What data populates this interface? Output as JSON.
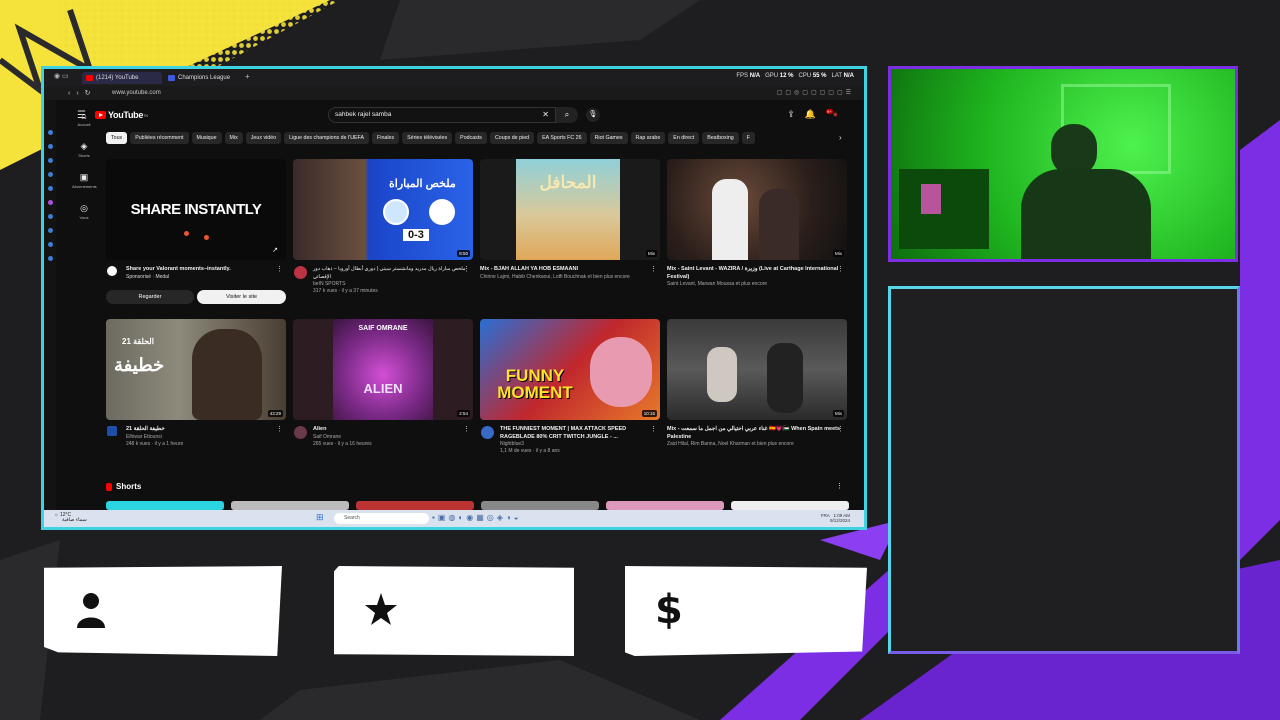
{
  "browser": {
    "tabs": [
      {
        "label": "(1214) YouTube",
        "favicon_color": "#ff0000"
      },
      {
        "label": "Champions League Stand...",
        "favicon_color": "#3b5bdb"
      }
    ],
    "new_tab": "+",
    "stats": {
      "fps_label": "FPS",
      "fps": "N/A",
      "gpu_label": "GPU",
      "gpu": "12 %",
      "cpu_label": "CPU",
      "cpu": "55 %",
      "lat_label": "LAT",
      "lat": "N/A"
    },
    "url": "www.youtube.com"
  },
  "youtube": {
    "logo": "YouTube",
    "logo_region": "TN",
    "search_value": "sahbek rajel samba",
    "notification_count": "9+",
    "left_nav": [
      {
        "label": "Accueil",
        "icon": "home-icon"
      },
      {
        "label": "Shorts",
        "icon": "shorts-icon"
      },
      {
        "label": "Abonnements",
        "icon": "subscriptions-icon"
      },
      {
        "label": "Vous",
        "icon": "you-icon"
      }
    ],
    "chips": [
      "Tous",
      "Publiées récemment",
      "Musique",
      "Mix",
      "Jeux vidéo",
      "Ligue des champions de l'UEFA",
      "Finales",
      "Séries télévisées",
      "Podcasts",
      "Coups de pied",
      "EA Sports FC 26",
      "Riot Games",
      "Rap arabe",
      "En direct",
      "Beatboxing",
      "F"
    ],
    "videos": [
      {
        "thumb_text": "SHARE INSTANTLY",
        "duration": "",
        "title": "Share your Valorant moments–instantly.",
        "line2": "Sponsorisé · Medal",
        "line3": "",
        "ad_buttons": [
          "Regarder",
          "Visiter le site"
        ]
      },
      {
        "thumb_text": "ملخص المباراة",
        "score": "0-3",
        "duration": "8:50",
        "title": "ملخص مباراة ريال مدريد ومانشستر سيتي | دوري أبطال أوروبا – ذهاب دور الإقصائي",
        "line2": "beIN SPORTS",
        "line3": "317 k vues · il y a 37 minutes"
      },
      {
        "thumb_text": "المحافل",
        "duration": "Mix",
        "title": "Mix - BJAH ALLAH YA HOB ESMAANI",
        "line2": "Chirine Lajmi, Habib Chenkaoui, Lotfi Bouchnak et bien plus encore",
        "line3": ""
      },
      {
        "thumb_text": "",
        "duration": "Mix",
        "title": "Mix - Saint Levant - WAZIRA / وزيرة (Live at Carthage International Festival)",
        "line2": "Saint Levant, Marwan Moussa et plus encore",
        "line3": ""
      },
      {
        "thumb_text": "الحلقة 21",
        "thumb_text2": "خطيفة",
        "duration": "43:29",
        "title": "خطيفة الحلقة 21",
        "line2": "Elhiwar Ettounsi",
        "line3": "248 k vues · il y a 1 heure"
      },
      {
        "thumb_text": "SAIF OMRANE",
        "thumb_text2": "ALIEN",
        "duration": "2:54",
        "title": "Alien",
        "line2": "Saif Omrane",
        "line3": "265 vues · il y a 16 heures"
      },
      {
        "thumb_text": "FUNNY MOMENT",
        "duration": "10:16",
        "title": "THE FUNNIEST MOMENT | MAX ATTACK SPEED RAGEBLADE 80% CRIT TWITCH JUNGLE - ...",
        "line2": "Nightblue3",
        "line3": "1,1 M de vues · il y a 8 ans"
      },
      {
        "thumb_text": "",
        "duration": "Mix",
        "title": "Mix - غناء عربي احتيالي من اجمل ما سمعت 🇪🇸💗🇵🇸 When Spain meets Palestine",
        "line2": "Zaid Hilal, Rim Banna, Noel Kharman et bien plus encore",
        "line3": ""
      }
    ],
    "shorts_label": "Shorts"
  },
  "taskbar": {
    "weather_temp": "12°C",
    "weather_desc": "سماء صافية",
    "search_placeholder": "Search",
    "lang": "FRA",
    "time": "1:09 AM",
    "date": "9/12/2024"
  },
  "overlay": {
    "plates": [
      {
        "icon": "user-icon"
      },
      {
        "icon": "star-icon"
      },
      {
        "icon": "dollar-icon"
      }
    ],
    "dollar_glyph": "$",
    "colors": {
      "frame_cyan": "#3fd3e2",
      "accent_purple": "#7b2ee4",
      "accent_yellow": "#f5e23a"
    }
  }
}
